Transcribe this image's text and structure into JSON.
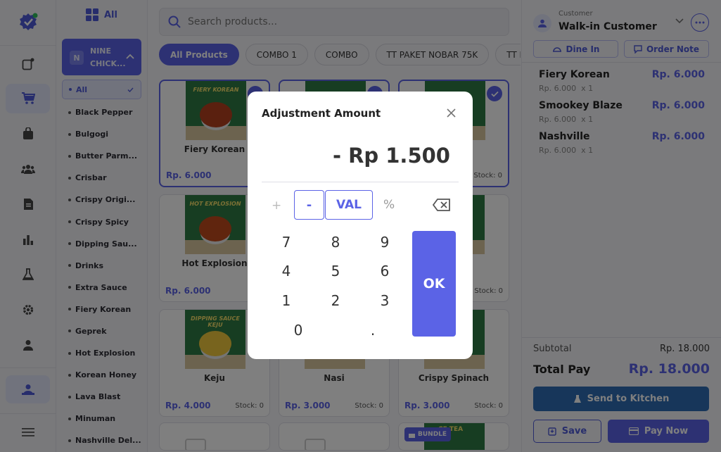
{
  "sidebar_nav": {
    "items": [
      "logo-icon",
      "new-order-icon",
      "cart-icon",
      "bag-icon",
      "customers-icon",
      "document-icon",
      "chart-icon",
      "flask-icon",
      "gear-icon",
      "user-icon",
      "account-icon",
      "menu-icon"
    ],
    "active": "cart-icon"
  },
  "categories": {
    "all_header": "All",
    "group_badge": "N",
    "group_name_line1": "NINE",
    "group_name_line2": "CHICK...",
    "items": [
      "All",
      "Black Pepper",
      "Bulgogi",
      "Butter Parm...",
      "Crisbar",
      "Crispy Origi...",
      "Crispy Spicy",
      "Dipping Sau...",
      "Drinks",
      "Extra Sauce",
      "Fiery Korean",
      "Geprek",
      "Hot Explosion",
      "Korean Honey",
      "Lava Blast",
      "Minuman",
      "Nashville Del..."
    ],
    "selected": "All"
  },
  "search": {
    "placeholder": "Search products..."
  },
  "chips": [
    "All Products",
    "COMBO 1",
    "COMBO",
    "TT PAKET NOBAR 75K",
    "TT P"
  ],
  "products": [
    {
      "name": "Fiery Korean",
      "label": "FIERY KOREAN",
      "price": "Rp. 6.000",
      "stock": "Stoc",
      "selected": true
    },
    {
      "name": "",
      "label": "",
      "price": "",
      "stock": "",
      "selected": true
    },
    {
      "name": "",
      "label": "",
      "price": "",
      "stock": "Stock: 0",
      "selected": true
    },
    {
      "name": "Hot Explosion",
      "label": "HOT EXPLOSION",
      "price": "Rp. 6.000",
      "stock": "Stoc",
      "selected": false
    },
    {
      "name": "",
      "label": "",
      "price": "",
      "stock": "",
      "selected": false
    },
    {
      "name": "e",
      "label": "",
      "price": "",
      "stock": "Stock: 0",
      "selected": false
    },
    {
      "name": "Keju",
      "label": "DIPPING SAUCE KEJU",
      "price": "Rp. 4.000",
      "stock": "Stock: 0",
      "selected": false
    },
    {
      "name": "Nasi",
      "label": "",
      "price": "Rp. 3.000",
      "stock": "Stock: 0",
      "selected": false
    },
    {
      "name": "Crispy Spinach",
      "label": "",
      "price": "Rp. 3.000",
      "stock": "Stock: 0",
      "selected": false
    }
  ],
  "bundle_badge": "BUNDLE",
  "bundle_img_text": "CE TEA",
  "customer": {
    "label": "Customer",
    "name": "Walk-in Customer"
  },
  "order_actions": {
    "dine_in": "Dine In",
    "order_note": "Order Note"
  },
  "order_items": [
    {
      "name": "Fiery Korean",
      "price": "Rp. 6.000",
      "detail": "Rp. 6.000  x 1"
    },
    {
      "name": "Smookey Blaze",
      "price": "Rp. 6.000",
      "detail": "Rp. 6.000  x 1"
    },
    {
      "name": "Nashville",
      "price": "Rp. 6.000",
      "detail": "Rp. 6.000  x 1"
    }
  ],
  "totals": {
    "subtotal_label": "Subtotal",
    "subtotal": "Rp. 18.000",
    "total_label": "Total Pay",
    "total": "Rp. 18.000"
  },
  "buttons": {
    "kitchen": "Send to Kitchen",
    "save": "Save",
    "pay": "Pay Now"
  },
  "modal": {
    "title": "Adjustment Amount",
    "amount": "- Rp 1.500",
    "plus": "+",
    "minus": "-",
    "val": "VAL",
    "percent": "%",
    "keys": [
      "7",
      "8",
      "9",
      "4",
      "5",
      "6",
      "1",
      "2",
      "3",
      "0",
      "."
    ],
    "ok": "OK"
  },
  "colors": {
    "accent": "#5b63e6",
    "kitchen": "#2e6db5",
    "price": "#5b63e6"
  }
}
